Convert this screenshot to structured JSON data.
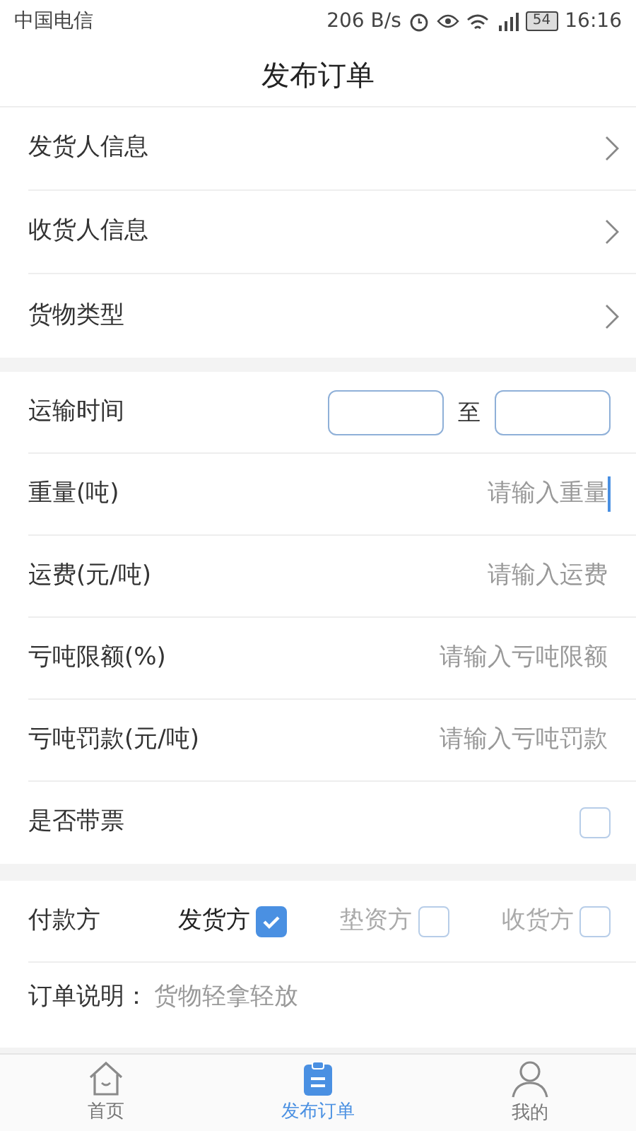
{
  "status_bar": {
    "carrier": "中国电信",
    "speed": "206 B/s",
    "battery": "54",
    "time": "16:16"
  },
  "header": {
    "title": "发布订单"
  },
  "nav_rows": [
    {
      "label": "发货人信息"
    },
    {
      "label": "收货人信息"
    },
    {
      "label": "货物类型"
    }
  ],
  "fields": [
    {
      "kind": "range",
      "label": "运输时间",
      "separator": "至"
    },
    {
      "kind": "input",
      "label": "重量(吨)",
      "placeholder": "请输入重量",
      "focused": true
    },
    {
      "kind": "input",
      "label": "运费(元/吨)",
      "placeholder": "请输入运费",
      "focused": false
    },
    {
      "kind": "input",
      "label": "亏吨限额(%)",
      "placeholder": "请输入亏吨限额",
      "focused": false
    },
    {
      "kind": "input",
      "label": "亏吨罚款(元/吨)",
      "placeholder": "请输入亏吨罚款",
      "focused": false
    },
    {
      "kind": "checkbox",
      "label": "是否带票",
      "checked": false
    }
  ],
  "payer": {
    "label": "付款方",
    "options": [
      {
        "label": "发货方",
        "selected": true
      },
      {
        "label": "垫资方",
        "selected": false
      },
      {
        "label": "收货方",
        "selected": false
      }
    ]
  },
  "note": {
    "label": "订单说明：",
    "value": "货物轻拿轻放"
  },
  "tab_bar": [
    {
      "label": "首页",
      "selected": false
    },
    {
      "label": "发布订单",
      "selected": true
    },
    {
      "label": "我的",
      "selected": false
    }
  ]
}
